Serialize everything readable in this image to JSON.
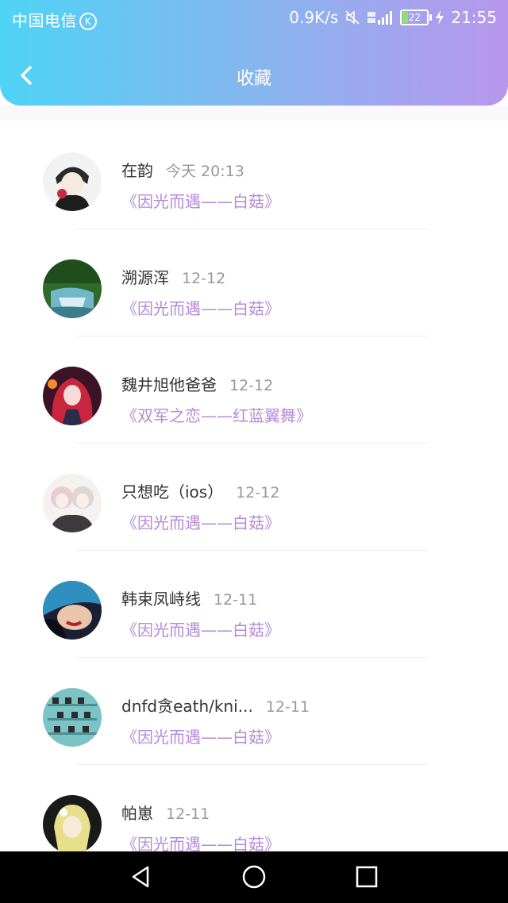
{
  "status_bar": {
    "carrier": "中国电信",
    "carrier_badge": "K",
    "network_speed": "0.9K/s",
    "battery": "22",
    "time": "21:55",
    "icons": [
      "mute-icon",
      "signal-icon",
      "battery-icon",
      "charging-icon"
    ]
  },
  "header": {
    "title": "收藏",
    "back_icon": "chevron-left-icon"
  },
  "colors": {
    "header_gradient": [
      "#4fd3f6",
      "#b896ec"
    ],
    "book_title": "#b58ad8",
    "name": "#333333",
    "time": "#999999"
  },
  "items": [
    {
      "name": "在韵",
      "time": "今天 20:13",
      "book": "《因光而遇——白菇》"
    },
    {
      "name": "溯源浑",
      "time": "12-12",
      "book": "《因光而遇——白菇》"
    },
    {
      "name": "魏井旭他爸爸",
      "time": "12-12",
      "book": "《双军之恋——红蓝翼舞》"
    },
    {
      "name": "只想吃（ios）",
      "time": "12-12",
      "book": "《因光而遇——白菇》"
    },
    {
      "name": "韩束凤峙线",
      "time": "12-11",
      "book": "《因光而遇——白菇》"
    },
    {
      "name": "dnfd贪eath/kni...",
      "time": "12-11",
      "book": "《因光而遇——白菇》"
    },
    {
      "name": "帕崽",
      "time": "12-11",
      "book": "《因光而遇——白菇》"
    }
  ],
  "nav_bar": {
    "icons": [
      "back-triangle-icon",
      "home-circle-icon",
      "recents-square-icon"
    ]
  }
}
